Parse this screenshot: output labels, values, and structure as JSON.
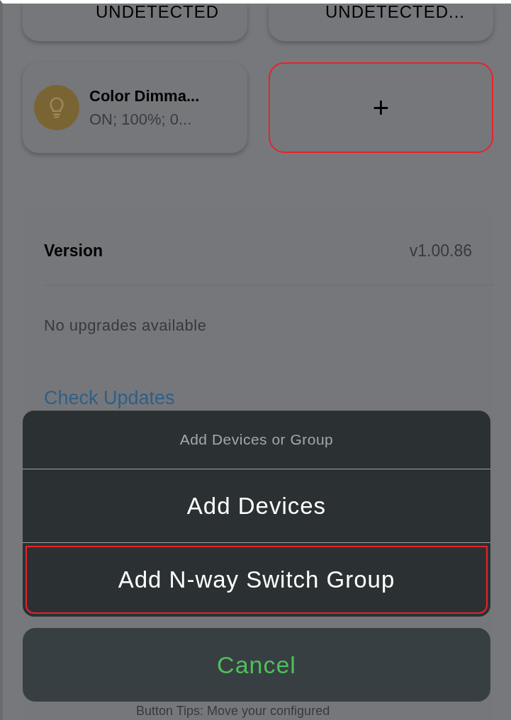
{
  "devices": [
    {
      "status": "UNDETECTED",
      "kind": "device"
    },
    {
      "status": "UNDETECTED...",
      "kind": "device"
    },
    {
      "name": "Color Dimma...",
      "status": "ON; 100%; 0...",
      "kind": "light"
    },
    {
      "kind": "add",
      "label": "+",
      "highlighted": true
    }
  ],
  "settings": {
    "version_label": "Version",
    "version_value": "v1.00.86",
    "upgrade_note": "No upgrades available",
    "check_link": "Check Updates",
    "tips": "Button Tips: Move your configured"
  },
  "action_sheet": {
    "title": "Add Devices or Group",
    "options": [
      {
        "label": "Add Devices",
        "highlighted": false
      },
      {
        "label": "Add N-way Switch Group",
        "highlighted": true
      }
    ],
    "cancel": "Cancel"
  }
}
